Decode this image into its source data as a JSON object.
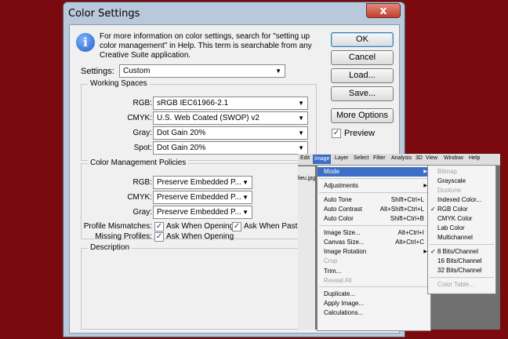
{
  "dialog": {
    "title": "Color Settings",
    "close_glyph": "x",
    "info_icon": "info-icon",
    "info_icon_glyph": "i",
    "info_text": "For more information on color settings, search for \"setting up color management\" in Help. This term is searchable from any Creative Suite application.",
    "settings_label": "Settings:",
    "settings_value": "Custom",
    "working_spaces": {
      "title": "Working Spaces",
      "rgb_label": "RGB:",
      "rgb_value": "sRGB IEC61966-2.1",
      "cmyk_label": "CMYK:",
      "cmyk_value": "U.S. Web Coated (SWOP) v2",
      "gray_label": "Gray:",
      "gray_value": "Dot Gain 20%",
      "spot_label": "Spot:",
      "spot_value": "Dot Gain 20%"
    },
    "policies": {
      "title": "Color Management Policies",
      "rgb_label": "RGB:",
      "rgb_value": "Preserve Embedded P...",
      "cmyk_label": "CMYK:",
      "cmyk_value": "Preserve Embedded P...",
      "gray_label": "Gray:",
      "gray_value": "Preserve Embedded P...",
      "mismatch_label": "Profile Mismatches:",
      "ask_opening": "Ask When Opening",
      "ask_pasting": "Ask When Pasting",
      "missing_label": "Missing Profiles:",
      "missing_ask_opening": "Ask When Opening"
    },
    "description_title": "Description",
    "buttons": {
      "ok": "OK",
      "cancel": "Cancel",
      "load": "Load...",
      "save": "Save...",
      "more_options": "More Options"
    },
    "preview_label": "Preview",
    "check_glyph": "✓",
    "arrow_glyph": "▼"
  },
  "photoshop": {
    "menubar": [
      "Edit",
      "Image",
      "Layer",
      "Select",
      "Filter",
      "Analysis",
      "3D",
      "View",
      "Window",
      "Help"
    ],
    "doc_tab": "lieu.jpg",
    "image_menu": [
      {
        "label": "Mode",
        "shortcut": "",
        "state": "highlighted",
        "submenu": true
      },
      {
        "label": "Adjustments",
        "shortcut": "",
        "state": "normal",
        "submenu": true
      },
      {
        "label": "Auto Tone",
        "shortcut": "Shift+Ctrl+L",
        "state": "normal"
      },
      {
        "label": "Auto Contrast",
        "shortcut": "Alt+Shift+Ctrl+L",
        "state": "normal"
      },
      {
        "label": "Auto Color",
        "shortcut": "Shift+Ctrl+B",
        "state": "normal"
      },
      {
        "label": "Image Size...",
        "shortcut": "Alt+Ctrl+I",
        "state": "normal"
      },
      {
        "label": "Canvas Size...",
        "shortcut": "Alt+Ctrl+C",
        "state": "normal"
      },
      {
        "label": "Image Rotation",
        "shortcut": "",
        "state": "normal",
        "submenu": true
      },
      {
        "label": "Crop",
        "shortcut": "",
        "state": "disabled"
      },
      {
        "label": "Trim...",
        "shortcut": "",
        "state": "normal"
      },
      {
        "label": "Reveal All",
        "shortcut": "",
        "state": "disabled"
      },
      {
        "label": "Duplicate...",
        "shortcut": "",
        "state": "normal"
      },
      {
        "label": "Apply Image...",
        "shortcut": "",
        "state": "normal"
      },
      {
        "label": "Calculations...",
        "shortcut": "",
        "state": "normal"
      }
    ],
    "submenu_arrow": "▶",
    "mode_menu": [
      {
        "label": "Bitmap",
        "state": "disabled"
      },
      {
        "label": "Grayscale",
        "state": "normal"
      },
      {
        "label": "Duotone",
        "state": "disabled"
      },
      {
        "label": "Indexed Color...",
        "state": "normal"
      },
      {
        "label": "RGB Color",
        "state": "checked"
      },
      {
        "label": "CMYK Color",
        "state": "normal"
      },
      {
        "label": "Lab Color",
        "state": "normal"
      },
      {
        "label": "Multichannel",
        "state": "normal"
      },
      {
        "label": "8 Bits/Channel",
        "state": "checked"
      },
      {
        "label": "16 Bits/Channel",
        "state": "normal"
      },
      {
        "label": "32 Bits/Channel",
        "state": "normal"
      },
      {
        "label": "Color Table...",
        "state": "disabled"
      }
    ]
  }
}
